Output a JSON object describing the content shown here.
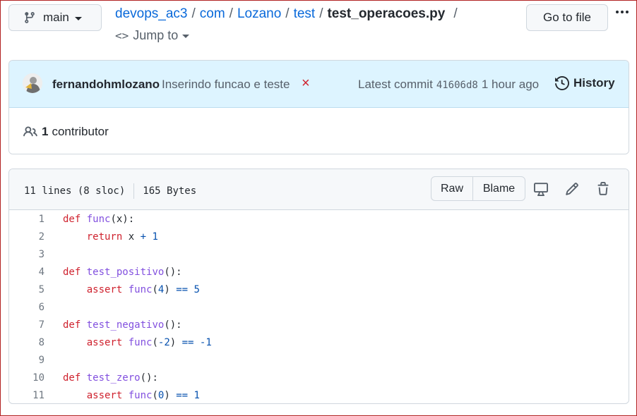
{
  "branch": {
    "label": "main",
    "icon": "git-branch-icon"
  },
  "breadcrumb": {
    "repo": "devops_ac3",
    "parts": [
      "com",
      "Lozano",
      "test"
    ],
    "file": "test_operacoes.py",
    "sep": "/"
  },
  "jump_to": {
    "label": "Jump to",
    "icon": "code-icon"
  },
  "goto_file": {
    "label": "Go to file"
  },
  "commit": {
    "author": "fernandohmlozano",
    "message": "Inserindo funcao e teste",
    "status": "×",
    "latest_label": "Latest commit",
    "sha": "41606d8",
    "time": "1 hour ago",
    "history_label": "History"
  },
  "contributors": {
    "count": "1",
    "label": "contributor"
  },
  "file": {
    "lines_info": "11 lines (8 sloc)",
    "size": "165 Bytes",
    "raw_label": "Raw",
    "blame_label": "Blame"
  },
  "code": {
    "line_numbers": [
      "1",
      "2",
      "3",
      "4",
      "5",
      "6",
      "7",
      "8",
      "9",
      "10",
      "11"
    ]
  },
  "colors": {
    "accent": "#0969da",
    "commit_bg": "#ddf4ff",
    "status_fail": "#cf222e",
    "keyword": "#cf222e",
    "function": "#8250df",
    "number": "#0550ae"
  }
}
